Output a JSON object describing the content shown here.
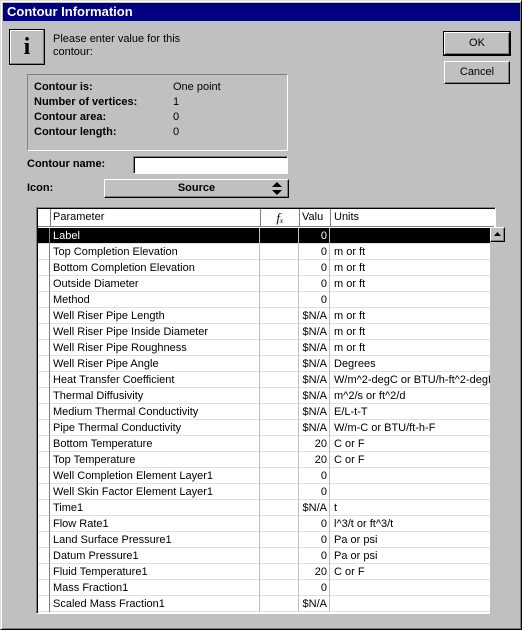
{
  "dialog": {
    "title": "Contour Information",
    "prompt": "Please enter value for this contour:"
  },
  "buttons": {
    "ok": "OK",
    "cancel": "Cancel"
  },
  "info": {
    "rows": [
      {
        "label": "Contour is:",
        "value": "One point"
      },
      {
        "label": "Number of vertices:",
        "value": "1"
      },
      {
        "label": "Contour area:",
        "value": "0"
      },
      {
        "label": "Contour length:",
        "value": "0"
      }
    ]
  },
  "form": {
    "name_label": "Contour name:",
    "name_value": "",
    "icon_label": "Icon:",
    "icon_value": "Source"
  },
  "grid": {
    "headers": {
      "parameter": "Parameter",
      "fx": "fₓ",
      "value": "Valu",
      "units": "Units"
    },
    "rows": [
      {
        "name": "Label",
        "value": "0",
        "units": "",
        "selected": true
      },
      {
        "name": "Top Completion Elevation",
        "value": "0",
        "units": "m or ft"
      },
      {
        "name": "Bottom Completion Elevation",
        "value": "0",
        "units": "m or ft"
      },
      {
        "name": "Outside Diameter",
        "value": "0",
        "units": "m or ft"
      },
      {
        "name": "Method",
        "value": "0",
        "units": ""
      },
      {
        "name": "Well Riser Pipe Length",
        "value": "$N/A",
        "units": "m or ft"
      },
      {
        "name": "Well Riser Pipe Inside Diameter",
        "value": "$N/A",
        "units": "m or ft"
      },
      {
        "name": "Well Riser Pipe Roughness",
        "value": "$N/A",
        "units": "m or ft"
      },
      {
        "name": "Well Riser Pipe Angle",
        "value": "$N/A",
        "units": "Degrees"
      },
      {
        "name": "Heat Transfer Coefficient",
        "value": "$N/A",
        "units": "W/m^2-degC or BTU/h-ft^2-degF"
      },
      {
        "name": "Thermal Diffusivity",
        "value": "$N/A",
        "units": "m^2/s or ft^2/d"
      },
      {
        "name": "Medium Thermal Conductivity",
        "value": "$N/A",
        "units": "E/L-t-T"
      },
      {
        "name": "Pipe Thermal Conductivity",
        "value": "$N/A",
        "units": "W/m-C or BTU/ft-h-F"
      },
      {
        "name": "Bottom Temperature",
        "value": "20",
        "units": "C or F"
      },
      {
        "name": "Top Temperature",
        "value": "20",
        "units": "C or F"
      },
      {
        "name": "Well Completion Element Layer1",
        "value": "0",
        "units": ""
      },
      {
        "name": "Well Skin Factor Element Layer1",
        "value": "0",
        "units": ""
      },
      {
        "name": "Time1",
        "value": "$N/A",
        "units": "t"
      },
      {
        "name": "Flow Rate1",
        "value": "0",
        "units": "l^3/t or ft^3/t"
      },
      {
        "name": "Land Surface Pressure1",
        "value": "0",
        "units": "Pa or psi"
      },
      {
        "name": "Datum Pressure1",
        "value": "0",
        "units": "Pa or psi"
      },
      {
        "name": "Fluid Temperature1",
        "value": "20",
        "units": "C or F"
      },
      {
        "name": "Mass Fraction1",
        "value": "0",
        "units": ""
      },
      {
        "name": "Scaled Mass Fraction1",
        "value": "$N/A",
        "units": ""
      }
    ]
  }
}
